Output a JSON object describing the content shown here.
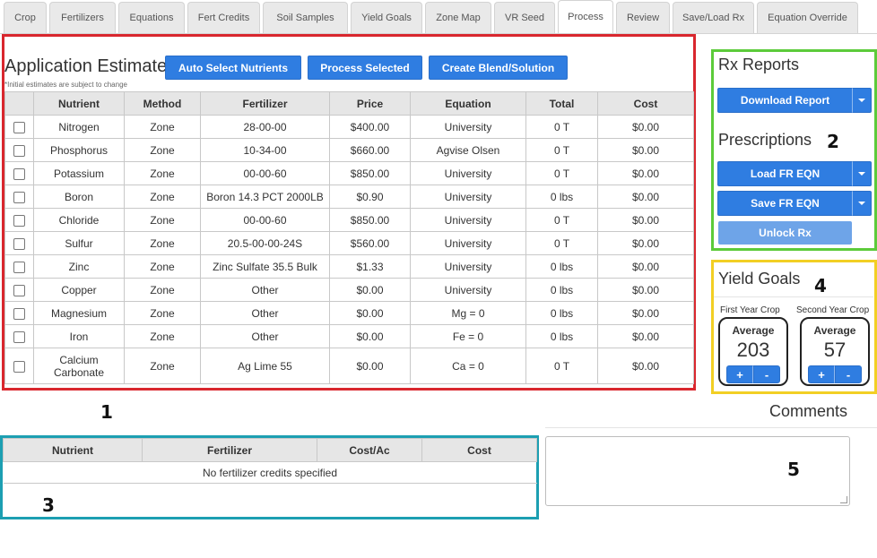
{
  "tabs": [
    "Crop",
    "Fertilizers",
    "Equations",
    "Fert Credits",
    "Soil Samples",
    "Yield Goals",
    "Zone Map",
    "VR Seed",
    "Process",
    "Review",
    "Save/Load Rx",
    "Equation Override"
  ],
  "active_tab": "Process",
  "app_estimate": {
    "title": "Application Estimate",
    "note": "*Initial estimates are subject to change",
    "buttons": {
      "auto_select": "Auto Select Nutrients",
      "process_selected": "Process Selected",
      "create_blend": "Create Blend/Solution"
    },
    "columns": [
      "Nutrient",
      "Method",
      "Fertilizer",
      "Price",
      "Equation",
      "Total",
      "Cost"
    ],
    "rows": [
      {
        "nutrient": "Nitrogen",
        "method": "Zone",
        "fertilizer": "28-00-00",
        "price": "$400.00",
        "equation": "University",
        "total": "0 T",
        "cost": "$0.00",
        "checked": false
      },
      {
        "nutrient": "Phosphorus",
        "method": "Zone",
        "fertilizer": "10-34-00",
        "price": "$660.00",
        "equation": "Agvise Olsen",
        "total": "0 T",
        "cost": "$0.00",
        "checked": false
      },
      {
        "nutrient": "Potassium",
        "method": "Zone",
        "fertilizer": "00-00-60",
        "price": "$850.00",
        "equation": "University",
        "total": "0 T",
        "cost": "$0.00",
        "checked": false
      },
      {
        "nutrient": "Boron",
        "method": "Zone",
        "fertilizer": "Boron 14.3 PCT 2000LB",
        "price": "$0.90",
        "equation": "University",
        "total": "0 lbs",
        "cost": "$0.00",
        "checked": false
      },
      {
        "nutrient": "Chloride",
        "method": "Zone",
        "fertilizer": "00-00-60",
        "price": "$850.00",
        "equation": "University",
        "total": "0 T",
        "cost": "$0.00",
        "checked": false
      },
      {
        "nutrient": "Sulfur",
        "method": "Zone",
        "fertilizer": "20.5-00-00-24S",
        "price": "$560.00",
        "equation": "University",
        "total": "0 T",
        "cost": "$0.00",
        "checked": false
      },
      {
        "nutrient": "Zinc",
        "method": "Zone",
        "fertilizer": "Zinc Sulfate 35.5 Bulk",
        "price": "$1.33",
        "equation": "University",
        "total": "0 lbs",
        "cost": "$0.00",
        "checked": false
      },
      {
        "nutrient": "Copper",
        "method": "Zone",
        "fertilizer": "Other",
        "price": "$0.00",
        "equation": "University",
        "total": "0 lbs",
        "cost": "$0.00",
        "checked": false
      },
      {
        "nutrient": "Magnesium",
        "method": "Zone",
        "fertilizer": "Other",
        "price": "$0.00",
        "equation": "Mg = 0",
        "total": "0 lbs",
        "cost": "$0.00",
        "checked": false
      },
      {
        "nutrient": "Iron",
        "method": "Zone",
        "fertilizer": "Other",
        "price": "$0.00",
        "equation": "Fe = 0",
        "total": "0 lbs",
        "cost": "$0.00",
        "checked": false
      },
      {
        "nutrient": "Calcium\nCarbonate",
        "method": "Zone",
        "fertilizer": "Ag Lime 55",
        "price": "$0.00",
        "equation": "Ca = 0",
        "total": "0 T",
        "cost": "$0.00",
        "checked": false
      }
    ]
  },
  "credits": {
    "columns": [
      "Nutrient",
      "Fertilizer",
      "Cost/Ac",
      "Cost"
    ],
    "empty_message": "No fertilizer credits specified"
  },
  "rx_reports": {
    "title": "Rx Reports",
    "download_label": "Download Report"
  },
  "prescriptions": {
    "title": "Prescriptions",
    "load_label": "Load FR EQN",
    "save_label": "Save FR EQN",
    "unlock_label": "Unlock Rx"
  },
  "yield_goals": {
    "title": "Yield Goals",
    "first": {
      "heading": "First Year Crop",
      "label": "Average",
      "value": "203"
    },
    "second": {
      "heading": "Second Year Crop",
      "label": "Average",
      "value": "57"
    },
    "plus": "+",
    "minus": "-"
  },
  "comments": {
    "title": "Comments",
    "value": ""
  },
  "callouts": [
    "1",
    "2",
    "3",
    "4",
    "5"
  ],
  "colors": {
    "accent_blue": "#2f7de1",
    "box_red": "#d9272e",
    "box_green": "#5ccb3a",
    "box_yellow": "#f2cf24",
    "box_teal": "#1c9fb2"
  }
}
